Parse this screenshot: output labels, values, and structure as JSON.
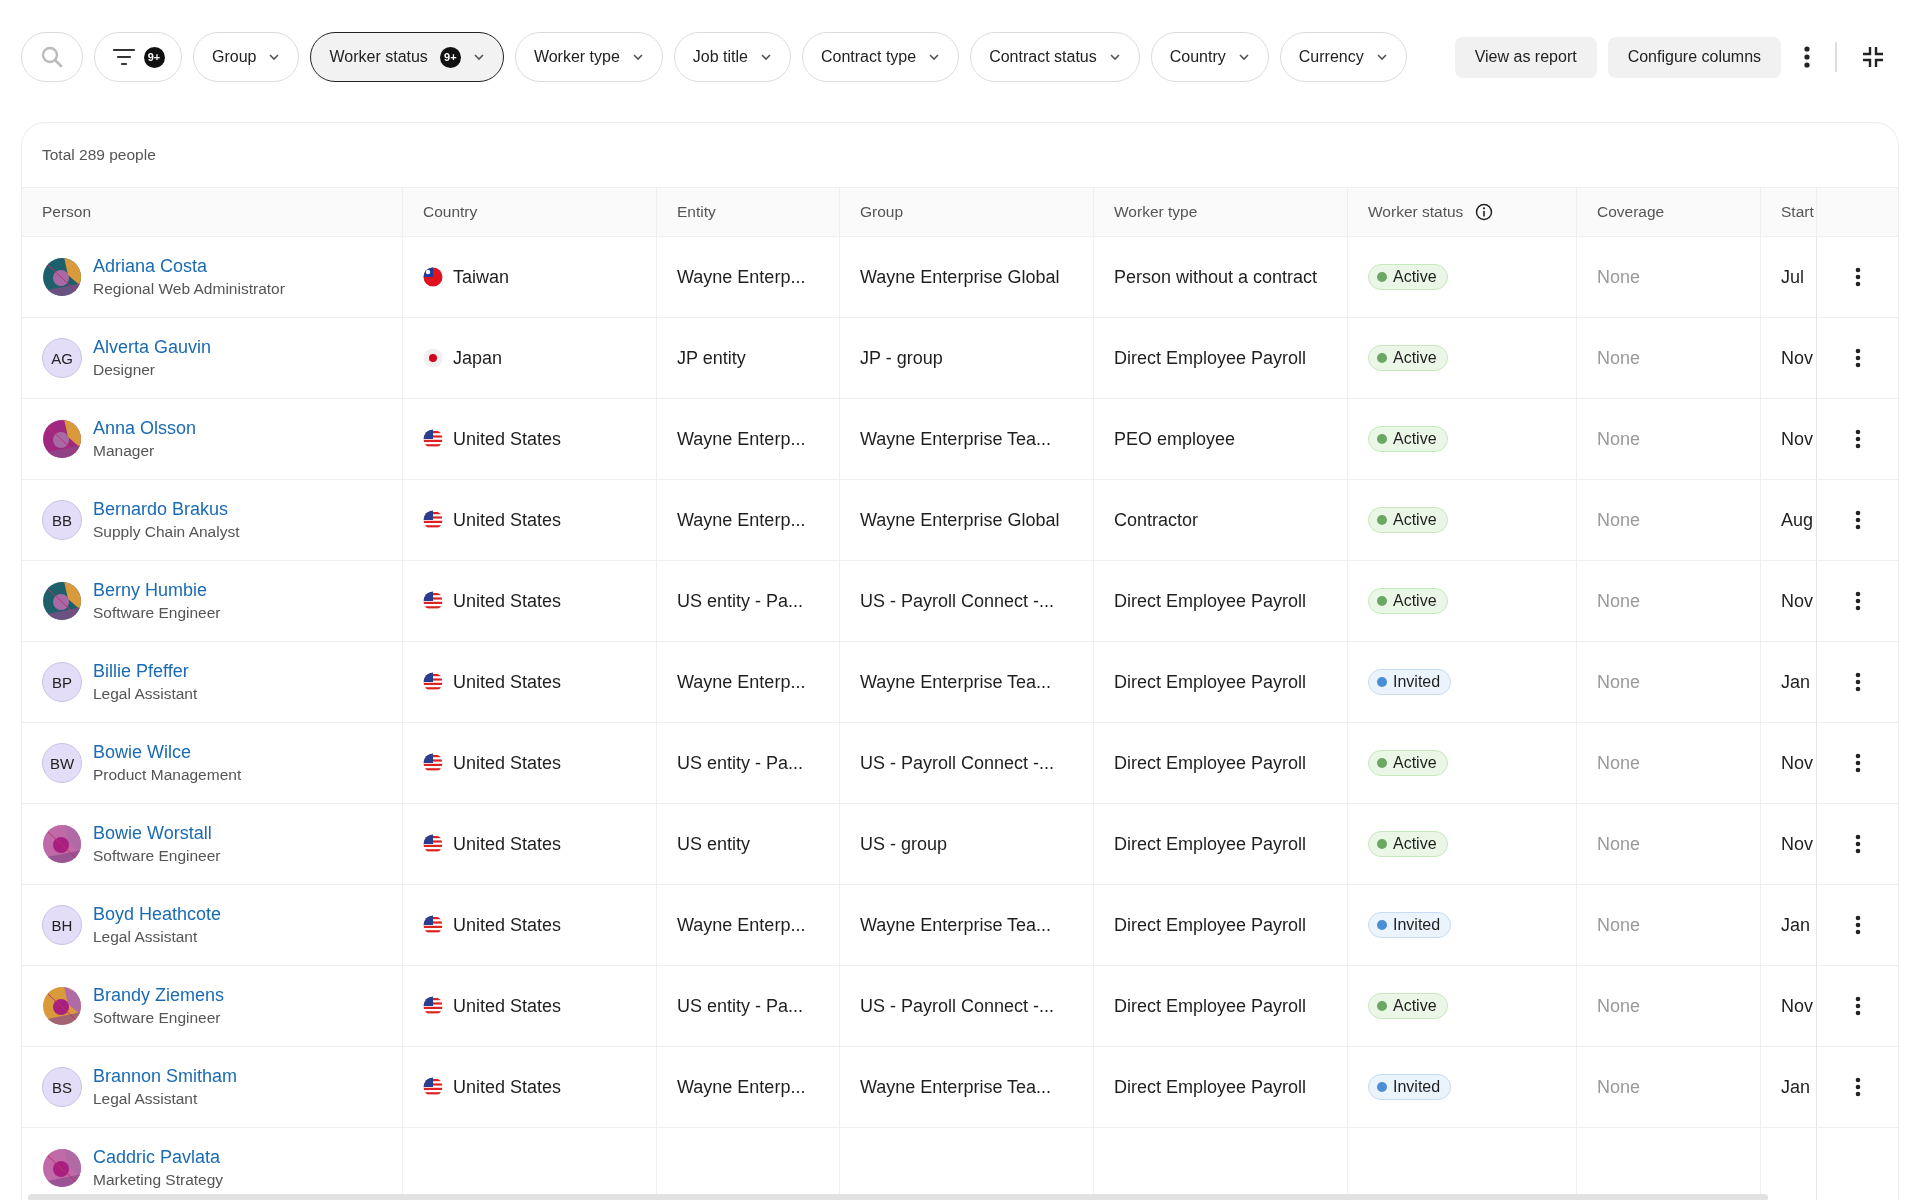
{
  "toolbar": {
    "filter_badge": "9+",
    "chips": [
      {
        "label": "Group",
        "selected": false
      },
      {
        "label": "Worker status",
        "selected": true,
        "badge": "9+"
      },
      {
        "label": "Worker type",
        "selected": false
      },
      {
        "label": "Job title",
        "selected": false
      },
      {
        "label": "Contract type",
        "selected": false
      },
      {
        "label": "Contract status",
        "selected": false
      },
      {
        "label": "Country",
        "selected": false
      },
      {
        "label": "Currency",
        "selected": false
      }
    ],
    "buttons": [
      "View as report",
      "Configure columns"
    ]
  },
  "table": {
    "total": "Total 289 people",
    "columns": [
      "Person",
      "Country",
      "Entity",
      "Group",
      "Worker type",
      "Worker status",
      "Coverage",
      "Start"
    ],
    "rows": [
      {
        "name": "Adriana Costa",
        "title": "Regional Web Administrator",
        "country": "Taiwan",
        "kind": "tw",
        "entity": "Wayne Enterp...",
        "group": "Wayne Enterprise Global",
        "worker_type": "Person without a contract",
        "status": {
          "kind": "active",
          "label": "Active",
          "color": "#6aa864"
        },
        "coverage": "None",
        "start": "Jul"
      },
      {
        "avatar": {
          "kind": "initials",
          "initials": "AG"
        },
        "name": "Alverta Gauvin",
        "title": "Designer",
        "country": "Japan",
        "kind": "jp",
        "entity": "JP entity",
        "group": "JP - group",
        "worker_type": "Direct Employee Payroll",
        "status": {
          "kind": "active",
          "label": "Active",
          "color": "#6aa864"
        },
        "coverage": "None",
        "start": "Nov"
      },
      {
        "name": "Anna Olsson",
        "title": "Manager",
        "country": "United States",
        "kind": "us",
        "entity": "Wayne Enterp...",
        "group": "Wayne Enterprise Tea...",
        "worker_type": "PEO employee",
        "status": {
          "kind": "active",
          "label": "Active",
          "color": "#6aa864"
        },
        "coverage": "None",
        "start": "Nov"
      },
      {
        "avatar": {
          "kind": "initials",
          "initials": "BB"
        },
        "name": "Bernardo Brakus",
        "title": "Supply Chain Analyst",
        "country": "United States",
        "kind": "us",
        "entity": "Wayne Enterp...",
        "group": "Wayne Enterprise Global",
        "worker_type": "Contractor",
        "status": {
          "kind": "active",
          "label": "Active",
          "color": "#6aa864"
        },
        "coverage": "None",
        "start": "Aug"
      },
      {
        "name": "Berny Humbie",
        "title": "Software Engineer",
        "country": "United States",
        "kind": "us",
        "entity": "US entity - Pa...",
        "group": "US - Payroll Connect -...",
        "worker_type": "Direct Employee Payroll",
        "status": {
          "kind": "active",
          "label": "Active",
          "color": "#6aa864"
        },
        "coverage": "None",
        "start": "Nov"
      },
      {
        "avatar": {
          "kind": "initials",
          "initials": "BP"
        },
        "name": "Billie Pfeffer",
        "title": "Legal Assistant",
        "country": "United States",
        "kind": "us",
        "entity": "Wayne Enterp...",
        "group": "Wayne Enterprise Tea...",
        "worker_type": "Direct Employee Payroll",
        "status": {
          "kind": "invited",
          "label": "Invited",
          "color": "#4a8fd6"
        },
        "coverage": "None",
        "start": "Jan"
      },
      {
        "avatar": {
          "kind": "initials",
          "initials": "BW"
        },
        "name": "Bowie Wilce",
        "title": "Product Management",
        "country": "United States",
        "kind": "us",
        "entity": "US entity - Pa...",
        "group": "US - Payroll Connect -...",
        "worker_type": "Direct Employee Payroll",
        "status": {
          "kind": "active",
          "label": "Active",
          "color": "#6aa864"
        },
        "coverage": "None",
        "start": "Nov"
      },
      {
        "name": "Bowie Worstall",
        "title": "Software Engineer",
        "country": "United States",
        "kind": "us",
        "entity": "US entity",
        "group": "US - group",
        "worker_type": "Direct Employee Payroll",
        "status": {
          "kind": "active",
          "label": "Active",
          "color": "#6aa864"
        },
        "coverage": "None",
        "start": "Nov"
      },
      {
        "avatar": {
          "kind": "initials",
          "initials": "BH"
        },
        "name": "Boyd Heathcote",
        "title": "Legal Assistant",
        "country": "United States",
        "kind": "us",
        "entity": "Wayne Enterp...",
        "group": "Wayne Enterprise Tea...",
        "worker_type": "Direct Employee Payroll",
        "status": {
          "kind": "invited",
          "label": "Invited",
          "color": "#4a8fd6"
        },
        "coverage": "None",
        "start": "Jan"
      },
      {
        "name": "Brandy Ziemens",
        "title": "Software Engineer",
        "country": "United States",
        "kind": "us",
        "entity": "US entity - Pa...",
        "group": "US - Payroll Connect -...",
        "worker_type": "Direct Employee Payroll",
        "status": {
          "kind": "active",
          "label": "Active",
          "color": "#6aa864"
        },
        "coverage": "None",
        "start": "Nov"
      },
      {
        "avatar": {
          "kind": "initials",
          "initials": "BS"
        },
        "name": "Brannon Smitham",
        "title": "Legal Assistant",
        "country": "United States",
        "kind": "us",
        "entity": "Wayne Enterp...",
        "group": "Wayne Enterprise Tea...",
        "worker_type": "Direct Employee Payroll",
        "status": {
          "kind": "invited",
          "label": "Invited",
          "color": "#4a8fd6"
        },
        "coverage": "None",
        "start": "Jan"
      },
      {
        "name": "Caddric Pavlata",
        "title": "Marketing Strategy"
      }
    ]
  }
}
